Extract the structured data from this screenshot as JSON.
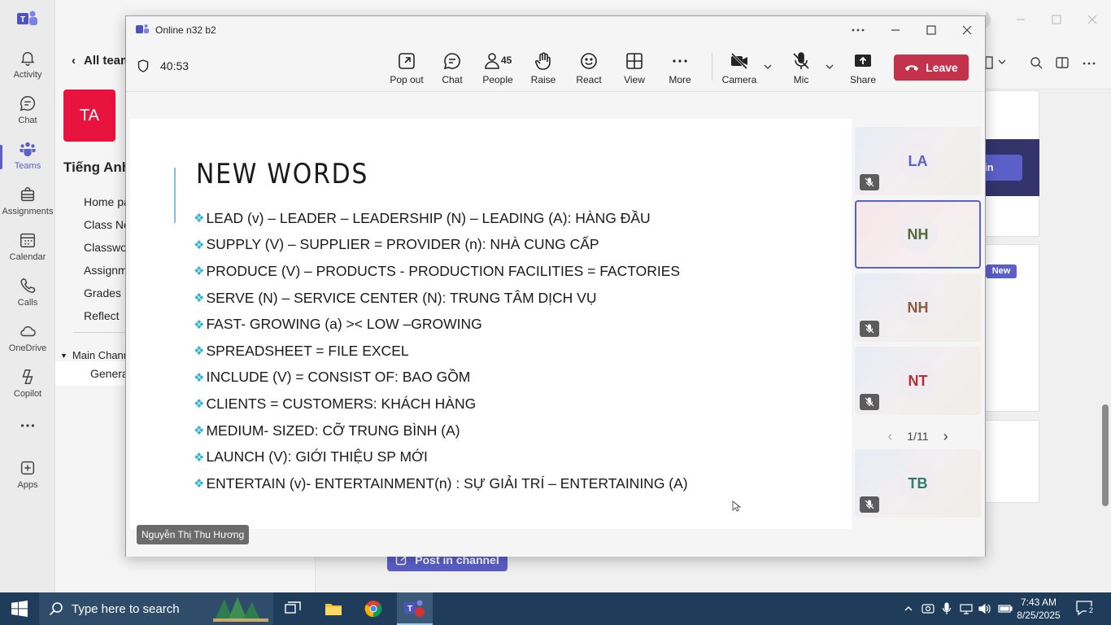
{
  "rail": {
    "items": [
      {
        "label": "Activity",
        "icon": "bell-icon"
      },
      {
        "label": "Chat",
        "icon": "chat-icon"
      },
      {
        "label": "Teams",
        "icon": "teams-icon"
      },
      {
        "label": "Assignments",
        "icon": "assignments-icon"
      },
      {
        "label": "Calendar",
        "icon": "calendar-icon"
      },
      {
        "label": "Calls",
        "icon": "phone-icon"
      },
      {
        "label": "OneDrive",
        "icon": "cloud-icon"
      },
      {
        "label": "Copilot",
        "icon": "copilot-icon"
      },
      {
        "label": "",
        "icon": "more-icon"
      },
      {
        "label": "Apps",
        "icon": "apps-icon"
      }
    ]
  },
  "teams_pane": {
    "back_label": "All team",
    "team_initials": "TA",
    "team_name": "Tiếng Anh",
    "nav": [
      "Home pa",
      "Class No",
      "Classwo",
      "Assignm",
      "Grades",
      "Reflect"
    ],
    "channels_header": "Main Channe",
    "channel": "Genera"
  },
  "background": {
    "join_label": "in",
    "new_badge": "New",
    "post_button": "Post in channel"
  },
  "meeting": {
    "window_title": "Online n32 b2",
    "timer": "40:53",
    "toolbar": {
      "pop_out": "Pop out",
      "chat": "Chat",
      "people": "People",
      "people_count": "45",
      "raise": "Raise",
      "react": "React",
      "view": "View",
      "more": "More",
      "camera": "Camera",
      "mic": "Mic",
      "share": "Share",
      "leave": "Leave"
    },
    "slide": {
      "title": "NEW WORDS",
      "bullets": [
        " LEAD (v) – LEADER – LEADERSHIP (N) – LEADING (A): HÀNG ĐẦU",
        "SUPPLY (V) – SUPPLIER = PROVIDER (n): NHÀ CUNG CẤP",
        "PRODUCE (V) – PRODUCTS -  PRODUCTION FACILITIES = FACTORIES",
        "SERVE (N) – SERVICE CENTER (N): TRUNG TÂM DỊCH VỤ",
        "FAST- GROWING (a) >< LOW –GROWING",
        "SPREADSHEET = FILE EXCEL",
        "INCLUDE (V) = CONSIST OF: BAO GỒM",
        "CLIENTS = CUSTOMERS: KHÁCH HÀNG",
        "MEDIUM- SIZED: CỠ TRUNG BÌNH (A)",
        "LAUNCH (V): GIỚI THIỆU SP MỚI",
        "ENTERTAIN (v)- ENTERTAINMENT(n) : SỰ GIẢI TRÍ – ENTERTAINING (A)"
      ]
    },
    "presenter_name": "Nguyễn Thị Thu Hương",
    "participants": [
      {
        "initials": "LA",
        "muted": true,
        "selected": false,
        "color": "#5b5fc7"
      },
      {
        "initials": "NH",
        "muted": false,
        "selected": true,
        "color": "#4f6b3a"
      },
      {
        "initials": "NH",
        "muted": true,
        "selected": false,
        "color": "#8a5a44"
      },
      {
        "initials": "NT",
        "muted": true,
        "selected": false,
        "color": "#b0303c"
      },
      {
        "initials": "TB",
        "muted": true,
        "selected": false,
        "color": "#2f7d6f"
      }
    ],
    "pager": "1/11"
  },
  "taskbar": {
    "search_placeholder": "Type here to search",
    "time": "7:43 AM",
    "date": "8/25/2025",
    "notification_count": "2"
  }
}
